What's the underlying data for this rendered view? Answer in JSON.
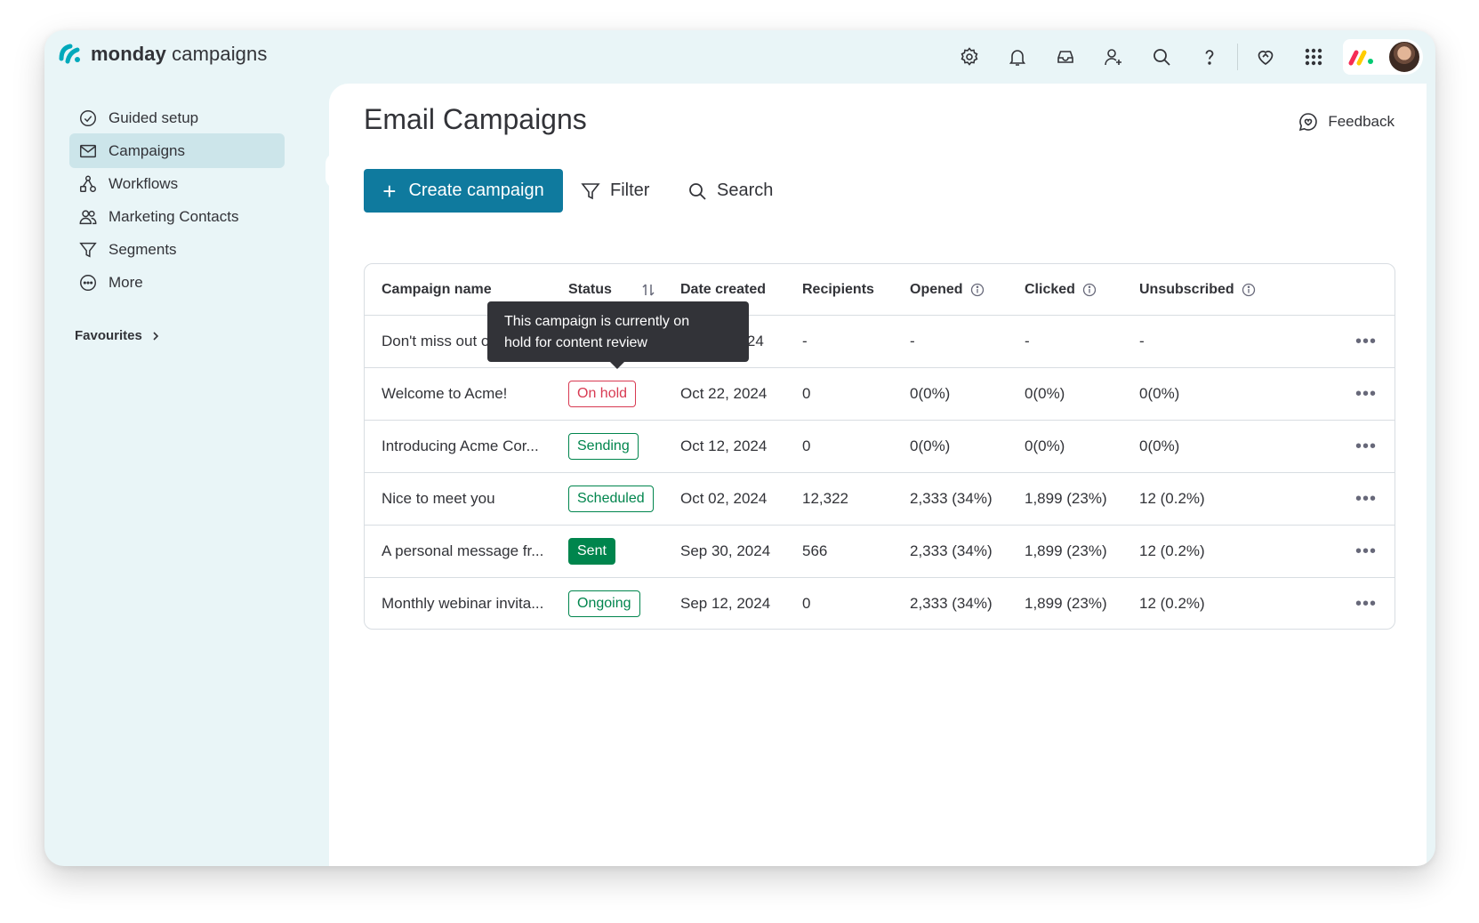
{
  "app": {
    "brand_bold": "monday",
    "brand_light": " campaigns"
  },
  "topbar": {
    "icons": [
      "settings-icon",
      "bell-icon",
      "inbox-icon",
      "invite-user-icon",
      "search-icon",
      "help-icon",
      "heart-icon",
      "apps-grid-icon"
    ]
  },
  "sidebar": {
    "items": [
      {
        "label": "Guided setup",
        "icon": "check-circle-icon"
      },
      {
        "label": "Campaigns",
        "icon": "mail-icon",
        "active": true
      },
      {
        "label": "Workflows",
        "icon": "workflow-icon"
      },
      {
        "label": "Marketing Contacts",
        "icon": "contacts-icon"
      },
      {
        "label": "Segments",
        "icon": "filter-icon"
      },
      {
        "label": "More",
        "icon": "more-circle-icon"
      }
    ],
    "favourites_label": "Favourites"
  },
  "main": {
    "title": "Email Campaigns",
    "feedback_label": "Feedback",
    "create_label": "Create campaign",
    "filter_label": "Filter",
    "search_label": "Search"
  },
  "table": {
    "headers": {
      "name": "Campaign name",
      "status": "Status",
      "date": "Date created",
      "recipients": "Recipients",
      "opened": "Opened",
      "clicked": "Clicked",
      "unsubscribed": "Unsubscribed"
    },
    "rows": [
      {
        "name": "Don't miss out o",
        "status": "",
        "date": "2024",
        "recipients": "-",
        "opened": "-",
        "clicked": "-",
        "unsubscribed": "-"
      },
      {
        "name": "Welcome to Acme!",
        "status": "On hold",
        "date": "Oct 22, 2024",
        "recipients": "0",
        "opened": "0(0%)",
        "clicked": "0(0%)",
        "unsubscribed": "0(0%)"
      },
      {
        "name": "Introducing Acme Cor...",
        "status": "Sending",
        "date": "Oct 12, 2024",
        "recipients": "0",
        "opened": "0(0%)",
        "clicked": "0(0%)",
        "unsubscribed": "0(0%)"
      },
      {
        "name": "Nice to meet you",
        "status": "Scheduled",
        "date": "Oct 02, 2024",
        "recipients": "12,322",
        "opened": "2,333 (34%)",
        "clicked": "1,899 (23%)",
        "unsubscribed": "12 (0.2%)"
      },
      {
        "name": "A personal message fr...",
        "status": "Sent",
        "date": "Sep 30, 2024",
        "recipients": "566",
        "opened": "2,333 (34%)",
        "clicked": "1,899 (23%)",
        "unsubscribed": "12 (0.2%)"
      },
      {
        "name": "Monthly webinar invita...",
        "status": "Ongoing",
        "date": "Sep 12, 2024",
        "recipients": "0",
        "opened": "2,333 (34%)",
        "clicked": "1,899 (23%)",
        "unsubscribed": "12 (0.2%)"
      }
    ]
  },
  "tooltip": {
    "line1": "This campaign is currently on",
    "line2": "hold for content review"
  },
  "colors": {
    "primary": "#0f7a9e",
    "sidebar_bg": "#e9f5f7",
    "active_nav": "#cce5ea",
    "on_hold": "#d83a52",
    "positive": "#00854d",
    "tooltip_bg": "#323338"
  }
}
